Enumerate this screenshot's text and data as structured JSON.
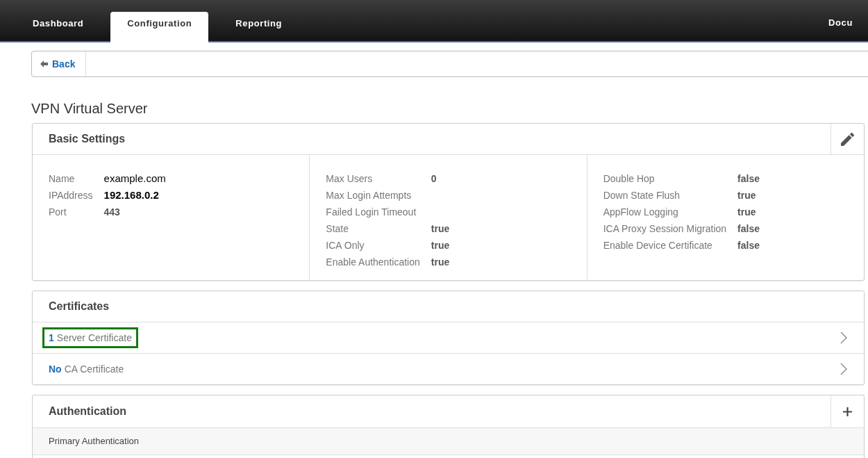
{
  "nav": {
    "tabs": [
      {
        "label": "Dashboard",
        "selected": false
      },
      {
        "label": "Configuration",
        "selected": true
      },
      {
        "label": "Reporting",
        "selected": false
      }
    ],
    "right_link": "Docu"
  },
  "back_button": {
    "label": "Back"
  },
  "page_title": "VPN Virtual Server",
  "basic_settings": {
    "title": "Basic Settings",
    "columns": [
      [
        {
          "label": "Name",
          "value": "example.com",
          "kind": "plain"
        },
        {
          "label": "IPAddress",
          "value": "192.168.0.2",
          "kind": "strong"
        },
        {
          "label": "Port",
          "value": "443",
          "kind": "value"
        }
      ],
      [
        {
          "label": "Max Users",
          "value": "0",
          "kind": "value"
        },
        {
          "label": "Max Login Attempts"
        },
        {
          "label": "Failed Login Timeout"
        },
        {
          "label": "State",
          "value": "true",
          "kind": "value"
        },
        {
          "label": "ICA Only",
          "value": "true",
          "kind": "value"
        },
        {
          "label": "Enable Authentication",
          "value": "true",
          "kind": "value"
        }
      ],
      [
        {
          "label": "Double Hop",
          "value": "false",
          "kind": "value"
        },
        {
          "label": "Down State Flush",
          "value": "true",
          "kind": "value"
        },
        {
          "label": "AppFlow Logging",
          "value": "true",
          "kind": "value"
        },
        {
          "label": "ICA Proxy Session Migration",
          "value": "false",
          "kind": "value"
        },
        {
          "label": "Enable Device Certificate",
          "value": "false",
          "kind": "value"
        }
      ]
    ]
  },
  "certificates": {
    "title": "Certificates",
    "rows": [
      {
        "count": "1",
        "label": "Server Certificate",
        "highlighted": true
      },
      {
        "count": "No",
        "label": "CA Certificate",
        "highlighted": false
      }
    ]
  },
  "authentication": {
    "title": "Authentication",
    "rows": [
      {
        "label": "Primary Authentication"
      }
    ]
  }
}
